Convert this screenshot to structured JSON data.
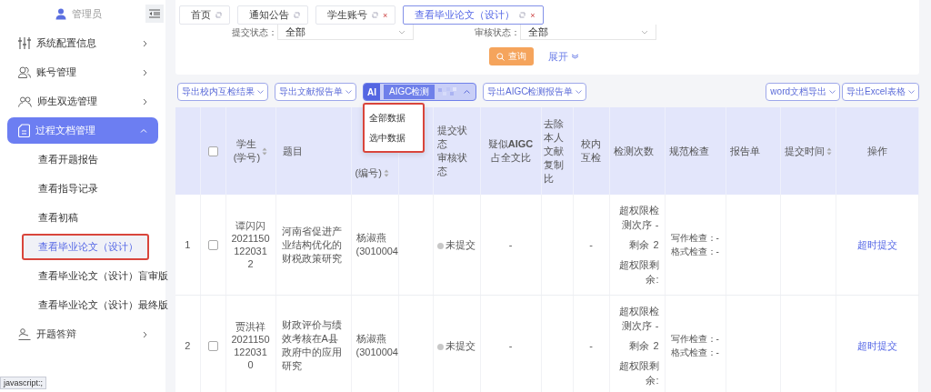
{
  "sidebar": {
    "user": "管理员",
    "items": [
      {
        "label": "系统配置信息",
        "expanded": false
      },
      {
        "label": "账号管理",
        "expanded": false
      },
      {
        "label": "师生双选管理",
        "expanded": false
      },
      {
        "label": "过程文档管理",
        "expanded": true,
        "children": [
          {
            "label": "查看开题报告",
            "selected": false,
            "outlined": false
          },
          {
            "label": "查看指导记录",
            "selected": false,
            "outlined": false
          },
          {
            "label": "查看初稿",
            "selected": false,
            "outlined": false
          },
          {
            "label": "查看毕业论文（设计）",
            "selected": true,
            "outlined": true
          },
          {
            "label": "查看毕业论文（设计）盲审版",
            "selected": false,
            "outlined": false
          },
          {
            "label": "查看毕业论文（设计）最终版",
            "selected": false,
            "outlined": false
          }
        ]
      },
      {
        "label": "开题答辩",
        "expanded": false
      }
    ]
  },
  "status_url": "javascript:;",
  "tabs": [
    {
      "label": "首页",
      "selected": false,
      "closable": false
    },
    {
      "label": "通知公告",
      "selected": false,
      "closable": false
    },
    {
      "label": "学生账号",
      "selected": false,
      "closable": true,
      "close": "×"
    },
    {
      "label": "查看毕业论文（设计）",
      "selected": true,
      "closable": true,
      "close": "×"
    }
  ],
  "filters": [
    {
      "label": "提交状态：",
      "value": "全部"
    },
    {
      "label": "审核状态：",
      "value": "全部"
    }
  ],
  "query_button": "查询",
  "expand_link": "展开",
  "toolbar_left": [
    {
      "kind": "plain",
      "label": "导出校内互检结果"
    },
    {
      "kind": "plain",
      "label": "导出文献报告单"
    },
    {
      "kind": "aigc",
      "badge": "AI",
      "label": "AIGC检测",
      "expanded": true
    },
    {
      "kind": "plain",
      "label": "导出AIGC检测报告单"
    }
  ],
  "toolbar_right": [
    {
      "label": "word文档导出"
    },
    {
      "label": "导出Excel表格"
    }
  ],
  "dropdown": {
    "outlined": true,
    "items": [
      "全部数据",
      "选中数据"
    ]
  },
  "columns": [
    {
      "kind": "index"
    },
    {
      "kind": "checkbox",
      "checked": false
    },
    {
      "kind": "text",
      "lines": [
        "学生",
        "(学号)"
      ],
      "sortable": true
    },
    {
      "kind": "text",
      "lines": [
        "题目"
      ],
      "sortable": false
    },
    {
      "kind": "text",
      "lines": [
        "(编号)"
      ],
      "sortable": true,
      "covered_top": true
    },
    {
      "kind": "blank"
    },
    {
      "kind": "text",
      "lines": [
        "提交状态",
        "审核状态"
      ],
      "sortable": false
    },
    {
      "kind": "text",
      "lines": [
        "疑似**AIGC**",
        "占全文比"
      ],
      "sortable": false
    },
    {
      "kind": "text",
      "lines": [
        "去除本人文献复制比"
      ],
      "sortable": false
    },
    {
      "kind": "text",
      "lines": [
        "校内互检"
      ],
      "sortable": false
    },
    {
      "kind": "text",
      "lines": [
        "检测次数"
      ],
      "sortable": false
    },
    {
      "kind": "text",
      "lines": [
        "规范检查"
      ],
      "sortable": false
    },
    {
      "kind": "text",
      "lines": [
        "报告单"
      ],
      "sortable": false
    },
    {
      "kind": "text",
      "lines": [
        "提交时间"
      ],
      "sortable": true
    },
    {
      "kind": "text",
      "lines": [
        "操作"
      ],
      "sortable": false
    }
  ],
  "rows": [
    {
      "index": "1",
      "checked": false,
      "student_name": "谭闪闪",
      "student_id": "20211501220312",
      "title": "河南省促进产业结构优化的财税政策研究",
      "teacher_name": "杨淑燕",
      "teacher_code": "(3010004",
      "status": {
        "label": "未提交",
        "color": "#c8c8c8"
      },
      "aigc": "-",
      "internal_check": "-",
      "count": [
        {
          "label": "超权限检测次序",
          "value": "-"
        },
        {
          "label": "剩余",
          "value": "2"
        },
        {
          "label": "超权限剩余:"
        }
      ],
      "norm": [
        "写作检查：-",
        "格式检查：-"
      ],
      "action": "超时提交"
    },
    {
      "index": "2",
      "checked": false,
      "student_name": "贾洪祥",
      "student_id": "20211501220310",
      "title": "财政评价与绩效考核在A县政府中的应用研究",
      "teacher_name": "杨淑燕",
      "teacher_code": "(3010004",
      "status": {
        "label": "未提交",
        "color": "#c8c8c8"
      },
      "aigc": "-",
      "internal_check": "-",
      "count": [
        {
          "label": "超权限检测次序",
          "value": "-"
        },
        {
          "label": "剩余",
          "value": "2"
        },
        {
          "label": "超权限剩余:"
        }
      ],
      "norm": [
        "写作检查：-",
        "格式检查：-"
      ],
      "action": "超时提交"
    }
  ]
}
